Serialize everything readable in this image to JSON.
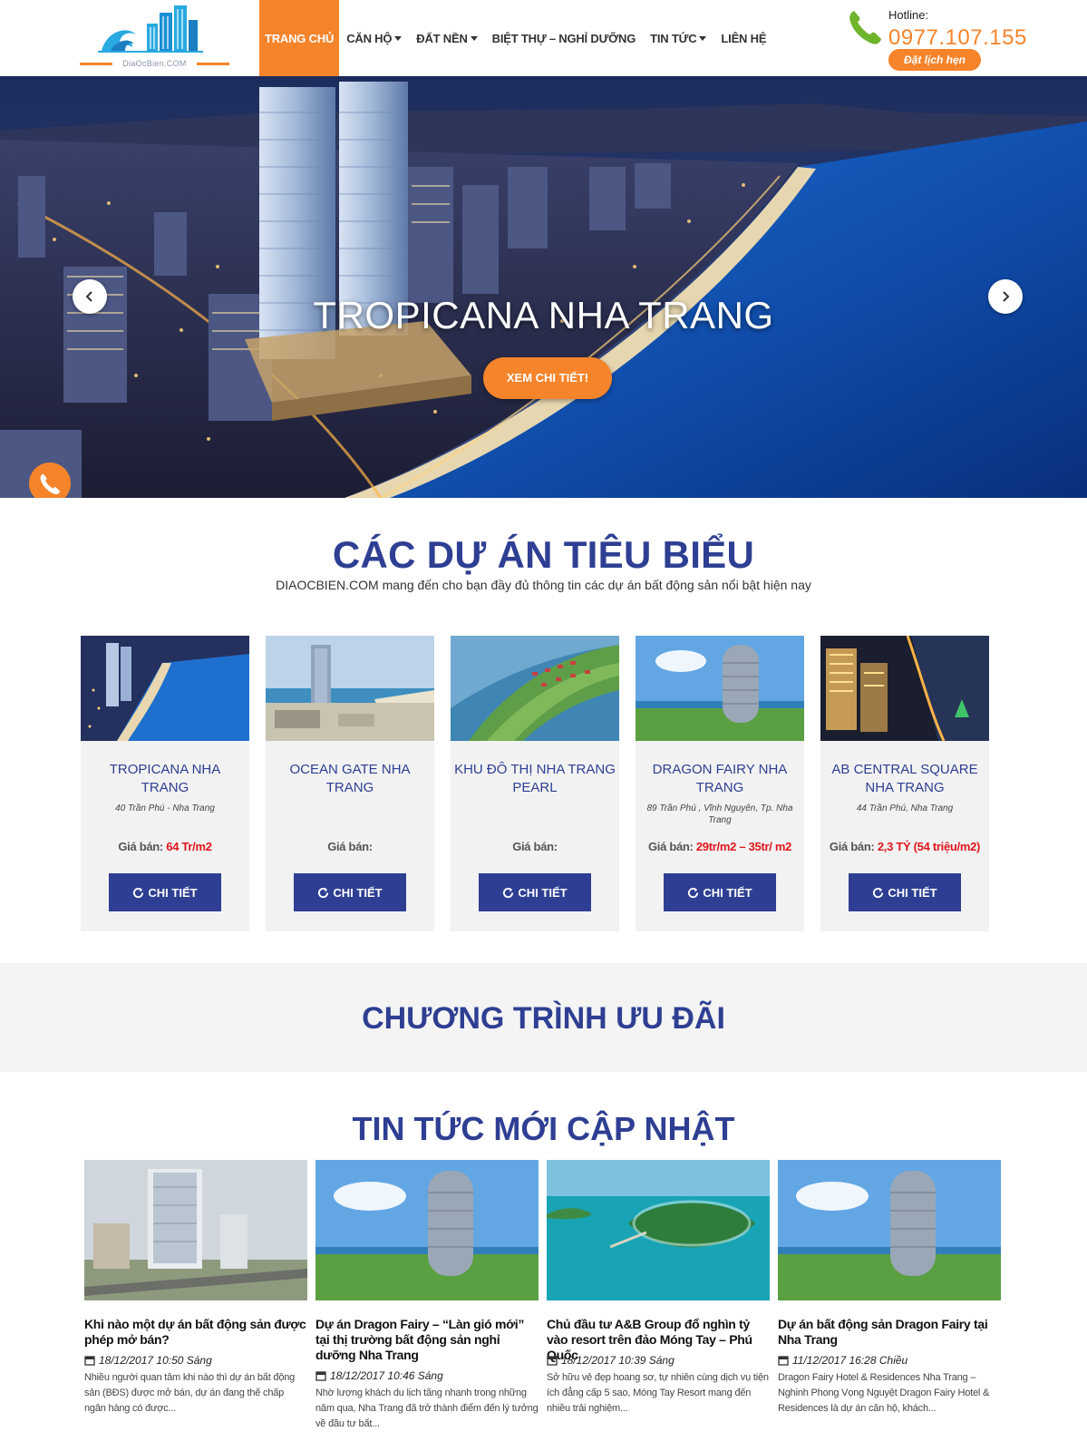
{
  "header": {
    "logo_text": "DiaOcBien.COM",
    "nav": [
      {
        "label": "TRANG CHỦ",
        "active": true,
        "dropdown": false
      },
      {
        "label": "CĂN HỘ",
        "active": false,
        "dropdown": true
      },
      {
        "label": "ĐẤT NỀN",
        "active": false,
        "dropdown": true
      },
      {
        "label": "BIỆT THỰ – NGHỈ DƯỠNG",
        "active": false,
        "dropdown": false
      },
      {
        "label": "TIN TỨC",
        "active": false,
        "dropdown": true
      },
      {
        "label": "LIÊN HỆ",
        "active": false,
        "dropdown": false
      }
    ],
    "hotline_label": "Hotline:",
    "hotline_number": "0977.107.155",
    "booking_label": "Đặt lịch hẹn"
  },
  "hero": {
    "title": "TROPICANA NHA TRANG",
    "button_label": "XEM CHI TIẾT!"
  },
  "projects": {
    "title": "CÁC DỰ ÁN TIÊU BIỂU",
    "subtitle": "DIAOCBIEN.COM mang đến cho bạn đầy đủ thông tin các dự án bất động sản nổi bật hiện nay",
    "price_label": "Giá bán:",
    "detail_label": "CHI TIẾT",
    "items": [
      {
        "name": "TROPICANA NHA TRANG",
        "address": "40 Trần Phú - Nha Trang",
        "price": "64 Tr/m2"
      },
      {
        "name": "OCEAN GATE NHA TRANG",
        "address": "",
        "price": ""
      },
      {
        "name": "KHU ĐÔ THỊ NHA TRANG PEARL",
        "address": "",
        "price": ""
      },
      {
        "name": "DRAGON FAIRY NHA TRANG",
        "address": "89 Trần Phú , Vĩnh Nguyên, Tp. Nha Trang",
        "price": "29tr/m2 – 35tr/ m2"
      },
      {
        "name": "AB CENTRAL SQUARE NHA TRANG",
        "address": "44 Trần Phú, Nha Trang",
        "price": "2,3 TỶ (54 triệu/m2)"
      }
    ]
  },
  "promo": {
    "title": "CHƯƠNG TRÌNH ƯU ĐÃI"
  },
  "news": {
    "title": "TIN TỨC MỚI CẬP NHẬT",
    "items": [
      {
        "title": "Khi nào một dự án bất động sản được phép mở bán?",
        "date": "18/12/2017 10:50 Sáng",
        "excerpt": "Nhiều người quan tâm khi nào thì dự án bất động sản (BĐS) được mở bán, dự án đang thế chấp ngân hàng có được..."
      },
      {
        "title": "Dự án Dragon Fairy – “Làn gió mới” tại thị trường bất động sản nghỉ dưỡng Nha Trang",
        "date": "18/12/2017 10:46 Sáng",
        "excerpt": "Nhờ lượng khách du lịch tăng nhanh trong những năm qua, Nha Trang đã trở thành điểm đến lý tưởng về đầu tư bất..."
      },
      {
        "title": "Chủ đầu tư A&B Group đổ nghìn tỷ vào resort trên đảo Móng Tay – Phú Quốc",
        "date": "18/12/2017 10:39 Sáng",
        "excerpt": "Sở hữu vẻ đẹp hoang sơ, tự nhiên cùng dịch vụ tiện ích đẳng cấp 5 sao, Móng Tay Resort mang đến nhiều trải nghiệm..."
      },
      {
        "title": "Dự án bất động sản Dragon Fairy tại Nha Trang",
        "date": "11/12/2017 16:28 Chiều",
        "excerpt": "Dragon Fairy Hotel & Residences Nha Trang – Nghinh Phong Vọng Nguyệt Dragon Fairy Hotel & Residences là dự án căn hộ, khách..."
      }
    ]
  },
  "colors": {
    "accent_orange": "#f6842a",
    "brand_blue": "#2e3f93",
    "price_red": "#e0151c"
  },
  "icons": [
    "logo-waves-buildings",
    "phone-icon",
    "caret-down-icon",
    "chevron-left-icon",
    "chevron-right-icon",
    "refresh-icon",
    "calendar-icon"
  ]
}
